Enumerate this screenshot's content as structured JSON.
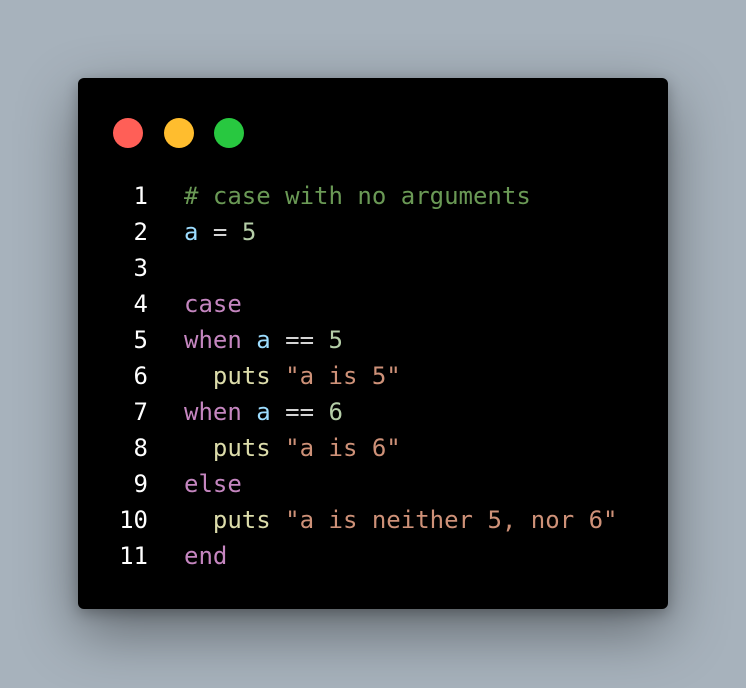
{
  "colors": {
    "background": "#a7b2bc",
    "window": "#000000",
    "line_number": "#ffffff",
    "comment": "#6a9955",
    "keyword": "#c586c0",
    "variable": "#9cdcfe",
    "number": "#b5cea8",
    "string": "#ce9178",
    "method": "#dcdcaa",
    "operator": "#d4d4d4",
    "traffic_red": "#ff5f57",
    "traffic_yellow": "#ffbd2e",
    "traffic_green": "#28c840"
  },
  "window_controls": [
    {
      "name": "close",
      "color": "#ff5f57"
    },
    {
      "name": "minimize",
      "color": "#ffbd2e"
    },
    {
      "name": "maximize",
      "color": "#28c840"
    }
  ],
  "code_lines": [
    {
      "number": "1",
      "tokens": [
        {
          "text": "# case with no arguments",
          "kind": "comment"
        }
      ]
    },
    {
      "number": "2",
      "tokens": [
        {
          "text": "a",
          "kind": "variable"
        },
        {
          "text": " = ",
          "kind": "operator"
        },
        {
          "text": "5",
          "kind": "number"
        }
      ]
    },
    {
      "number": "3",
      "tokens": []
    },
    {
      "number": "4",
      "tokens": [
        {
          "text": "case",
          "kind": "keyword"
        }
      ]
    },
    {
      "number": "5",
      "tokens": [
        {
          "text": "when",
          "kind": "keyword"
        },
        {
          "text": " ",
          "kind": "operator"
        },
        {
          "text": "a",
          "kind": "variable"
        },
        {
          "text": " == ",
          "kind": "operator"
        },
        {
          "text": "5",
          "kind": "number"
        }
      ]
    },
    {
      "number": "6",
      "tokens": [
        {
          "text": "  ",
          "kind": "operator"
        },
        {
          "text": "puts",
          "kind": "method"
        },
        {
          "text": " ",
          "kind": "operator"
        },
        {
          "text": "\"a is 5\"",
          "kind": "string"
        }
      ]
    },
    {
      "number": "7",
      "tokens": [
        {
          "text": "when",
          "kind": "keyword"
        },
        {
          "text": " ",
          "kind": "operator"
        },
        {
          "text": "a",
          "kind": "variable"
        },
        {
          "text": " == ",
          "kind": "operator"
        },
        {
          "text": "6",
          "kind": "number"
        }
      ]
    },
    {
      "number": "8",
      "tokens": [
        {
          "text": "  ",
          "kind": "operator"
        },
        {
          "text": "puts",
          "kind": "method"
        },
        {
          "text": " ",
          "kind": "operator"
        },
        {
          "text": "\"a is 6\"",
          "kind": "string"
        }
      ]
    },
    {
      "number": "9",
      "tokens": [
        {
          "text": "else",
          "kind": "keyword"
        }
      ]
    },
    {
      "number": "10",
      "tokens": [
        {
          "text": "  ",
          "kind": "operator"
        },
        {
          "text": "puts",
          "kind": "method"
        },
        {
          "text": " ",
          "kind": "operator"
        },
        {
          "text": "\"a is neither 5, nor 6\"",
          "kind": "string"
        }
      ]
    },
    {
      "number": "11",
      "tokens": [
        {
          "text": "end",
          "kind": "keyword"
        }
      ]
    }
  ]
}
